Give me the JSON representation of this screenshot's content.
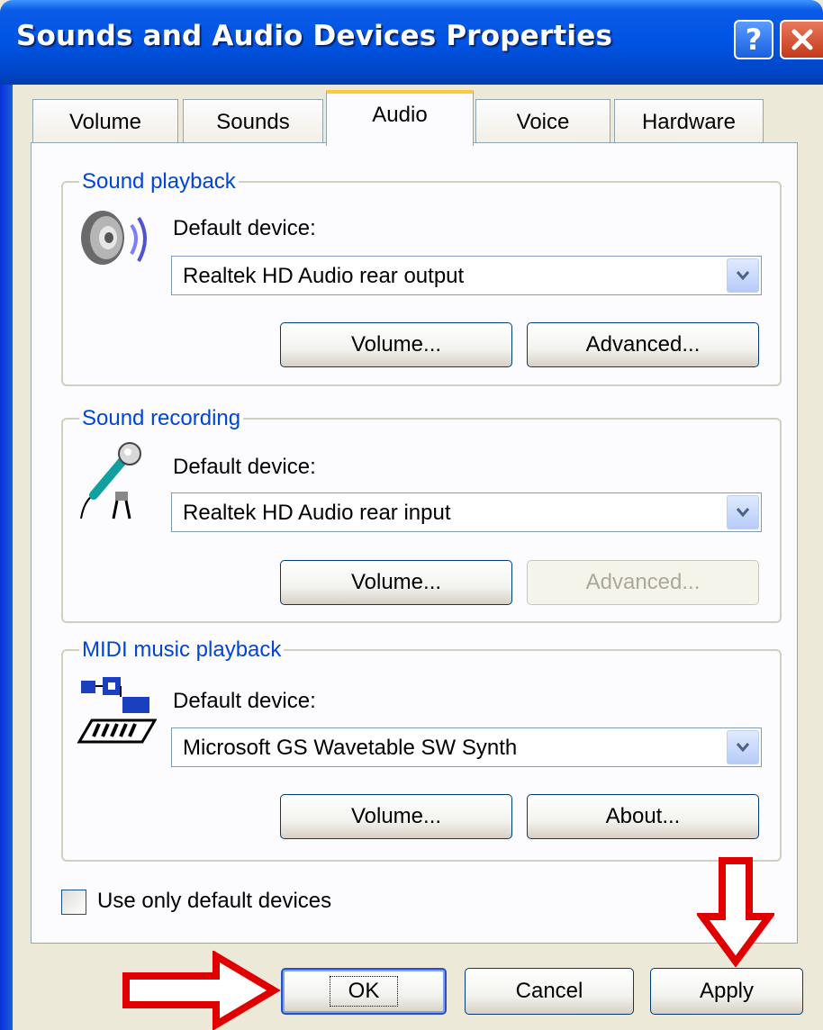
{
  "window": {
    "title": "Sounds and Audio Devices Properties"
  },
  "tabs": [
    {
      "label": "Volume"
    },
    {
      "label": "Sounds"
    },
    {
      "label": "Audio"
    },
    {
      "label": "Voice"
    },
    {
      "label": "Hardware"
    }
  ],
  "playback": {
    "legend": "Sound playback",
    "device_label": "Default device:",
    "device_value": "Realtek HD Audio rear output",
    "volume_button": "Volume...",
    "advanced_button": "Advanced...",
    "icon": "speaker-icon"
  },
  "recording": {
    "legend": "Sound recording",
    "device_label": "Default device:",
    "device_value": "Realtek HD Audio rear input",
    "volume_button": "Volume...",
    "advanced_button": "Advanced...",
    "icon": "microphone-icon"
  },
  "midi": {
    "legend": "MIDI music playback",
    "device_label": "Default device:",
    "device_value": "Microsoft GS Wavetable SW Synth",
    "volume_button": "Volume...",
    "about_button": "About...",
    "icon": "midi-keyboard-icon"
  },
  "options": {
    "use_default_only": "Use only default devices",
    "use_default_checked": false
  },
  "footer": {
    "ok": "OK",
    "cancel": "Cancel",
    "apply": "Apply"
  },
  "colors": {
    "title_blue": "#0054e3",
    "legend_blue": "#0046d5",
    "annotation_red": "#e00000",
    "tab_highlight": "#ffc83c"
  }
}
